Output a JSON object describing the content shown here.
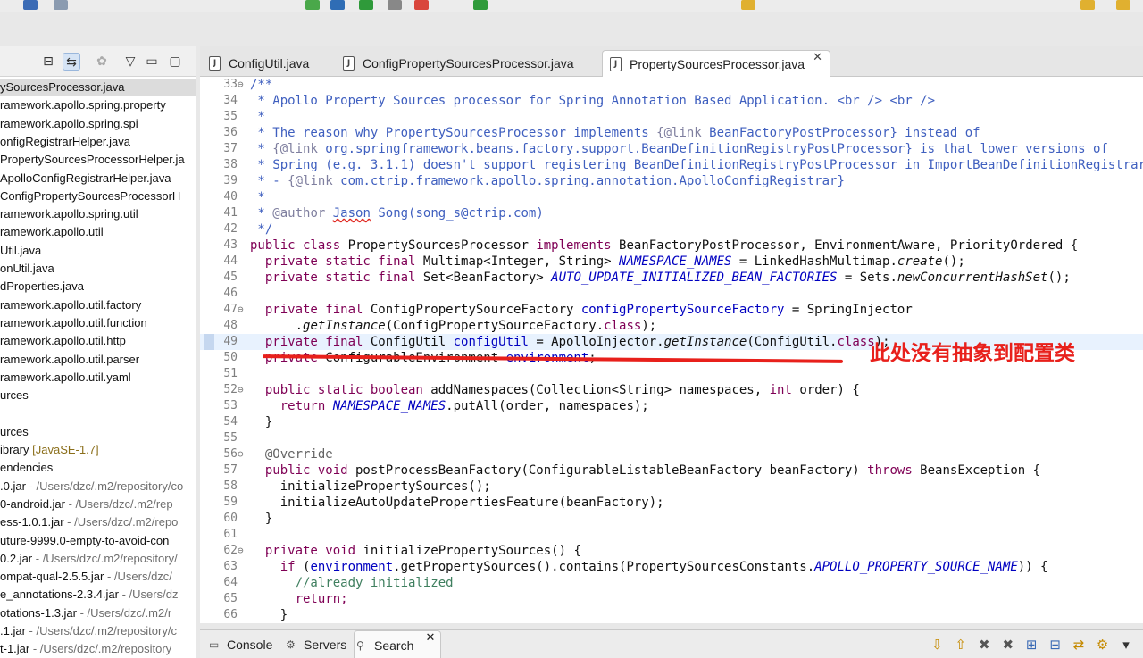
{
  "toolbar": {
    "icons": [
      "save-icon",
      "search-tool-icon",
      "debug-icon",
      "run-icon",
      "new-class-icon",
      "open-type-icon",
      "search-icon",
      "next-annotation-icon",
      "back-icon",
      "forward-icon"
    ]
  },
  "package_explorer": {
    "items": [
      {
        "label": "ySourcesProcessor.java",
        "selected": true
      },
      {
        "label": "ramework.apollo.spring.property"
      },
      {
        "label": "ramework.apollo.spring.spi"
      },
      {
        "label": "onfigRegistrarHelper.java"
      },
      {
        "label": "PropertySourcesProcessorHelper.ja"
      },
      {
        "label": "ApolloConfigRegistrarHelper.java"
      },
      {
        "label": "ConfigPropertySourcesProcessorH"
      },
      {
        "label": "ramework.apollo.spring.util"
      },
      {
        "label": "ramework.apollo.util"
      },
      {
        "label": "Util.java"
      },
      {
        "label": "onUtil.java"
      },
      {
        "label": "dProperties.java"
      },
      {
        "label": "ramework.apollo.util.factory"
      },
      {
        "label": "ramework.apollo.util.function"
      },
      {
        "label": "ramework.apollo.util.http"
      },
      {
        "label": "ramework.apollo.util.parser"
      },
      {
        "label": "ramework.apollo.util.yaml"
      },
      {
        "label": "urces"
      },
      {
        "label": ""
      },
      {
        "label": "urces"
      },
      {
        "label": "ibrary ",
        "lib": "[JavaSE-1.7]"
      },
      {
        "label": "endencies"
      },
      {
        "label": ".0.jar",
        "path": " - /Users/dzc/.m2/repository/co"
      },
      {
        "label": "0-android.jar",
        "path": " - /Users/dzc/.m2/rep"
      },
      {
        "label": "ess-1.0.1.jar",
        "path": " - /Users/dzc/.m2/repo"
      },
      {
        "label": "uture-9999.0-empty-to-avoid-con"
      },
      {
        "label": "0.2.jar",
        "path": " - /Users/dzc/.m2/repository/"
      },
      {
        "label": "ompat-qual-2.5.5.jar",
        "path": " - /Users/dzc/"
      },
      {
        "label": "e_annotations-2.3.4.jar",
        "path": " - /Users/dz"
      },
      {
        "label": "otations-1.3.jar",
        "path": " - /Users/dzc/.m2/r"
      },
      {
        "label": ".1.jar",
        "path": " - /Users/dzc/.m2/repository/c"
      },
      {
        "label": "t-1.jar",
        "path": " - /Users/dzc/.m2/repository"
      }
    ]
  },
  "editor_tabs": [
    {
      "label": "ConfigUtil.java",
      "active": false
    },
    {
      "label": "ConfigPropertySourcesProcessor.java",
      "active": false
    },
    {
      "label": "PropertySourcesProcessor.java",
      "active": true,
      "close": "✕"
    }
  ],
  "code_lines": {
    "l33": "/**",
    "l34": " * Apollo Property Sources processor for Spring Annotation Based Application. <br /> <br />",
    "l35": " *",
    "l36a": " * The reason why PropertySourcesProcessor implements ",
    "l36b": "{@link",
    "l36c": " BeanFactoryPostProcessor} instead of",
    "l37a": " * ",
    "l37b": "{@link",
    "l37c": " org.springframework.beans.factory.support.BeanDefinitionRegistryPostProcessor} is that lower versions of",
    "l38": " * Spring (e.g. 3.1.1) doesn't support registering BeanDefinitionRegistryPostProcessor in ImportBeanDefinitionRegistrar",
    "l39a": " * - ",
    "l39b": "{@link",
    "l39c": " com.ctrip.framework.apollo.spring.annotation.ApolloConfigRegistrar}",
    "l40": " *",
    "l41a": " * ",
    "l41b": "@author",
    "l41c": " ",
    "l41d": "Jason",
    "l41e": " Song(song_s@ctrip.com)",
    "l42": " */",
    "l43a": "public class",
    "l43b": " PropertySourcesProcessor ",
    "l43c": "implements",
    "l43d": " BeanFactoryPostProcessor, EnvironmentAware, PriorityOrdered {",
    "l44a": "  private static final",
    "l44b": " Multimap<Integer, String> ",
    "l44c": "NAMESPACE_NAMES",
    "l44d": " = LinkedHashMultimap.",
    "l44e": "create",
    "l44f": "();",
    "l45a": "  private static final",
    "l45b": " Set<BeanFactory> ",
    "l45c": "AUTO_UPDATE_INITIALIZED_BEAN_FACTORIES",
    "l45d": " = Sets.",
    "l45e": "newConcurrentHashSet",
    "l45f": "();",
    "l46": "",
    "l47a": "  private final",
    "l47b": " ConfigPropertySourceFactory ",
    "l47c": "configPropertySourceFactory",
    "l47d": " = SpringInjector",
    "l48a": "      .",
    "l48b": "getInstance",
    "l48c": "(ConfigPropertySourceFactory.",
    "l48d": "class",
    "l48e": ");",
    "l49a": "  private final",
    "l49b": " ConfigUtil ",
    "l49c": "configUtil",
    "l49d": " = ApolloInjector.",
    "l49e": "getInstance",
    "l49f": "(ConfigUtil.",
    "l49g": "class",
    "l49h": ");",
    "l50a": "  private",
    "l50b": " ConfigurableEnvironment ",
    "l50c": "environment",
    "l50d": ";",
    "l51": "",
    "l52a": "  public static boolean",
    "l52b": " addNamespaces(Collection<String> namespaces, ",
    "l52c": "int",
    "l52d": " order) {",
    "l53a": "    return ",
    "l53b": "NAMESPACE_NAMES",
    "l53c": ".putAll(order, namespaces);",
    "l54": "  }",
    "l55": "",
    "l56": "  @Override",
    "l57a": "  public void",
    "l57b": " postProcessBeanFactory(ConfigurableListableBeanFactory beanFactory) ",
    "l57c": "throws",
    "l57d": " BeansException {",
    "l58": "    initializePropertySources();",
    "l59": "    initializeAutoUpdatePropertiesFeature(beanFactory);",
    "l60": "  }",
    "l61": "",
    "l62a": "  private void",
    "l62b": " initializePropertySources() {",
    "l63a": "    if",
    "l63b": " (",
    "l63c": "environment",
    "l63d": ".getPropertySources().contains(PropertySourcesConstants.",
    "l63e": "APOLLO_PROPERTY_SOURCE_NAME",
    "l63f": ")) {",
    "l64": "      //already initialized",
    "l65": "      return;",
    "l66": "    }"
  },
  "line_numbers": [
    "33",
    "34",
    "35",
    "36",
    "37",
    "38",
    "39",
    "40",
    "41",
    "42",
    "43",
    "44",
    "45",
    "46",
    "47",
    "48",
    "49",
    "50",
    "51",
    "52",
    "53",
    "54",
    "55",
    "56",
    "57",
    "58",
    "59",
    "60",
    "61",
    "62",
    "63",
    "64",
    "65",
    "66"
  ],
  "annotation": {
    "text": "此处没有抽象到配置类",
    "color": "#e8201b"
  },
  "bottom_tabs": [
    {
      "label": "Console",
      "icon": "console-icon"
    },
    {
      "label": "Servers",
      "icon": "servers-icon"
    },
    {
      "label": "Search",
      "icon": "search-icon",
      "active": true,
      "close": "✕"
    }
  ],
  "bottom_icons": [
    "⇩",
    "⇧",
    "✖",
    "✖",
    "⊞",
    "⊟",
    "⇄",
    "⚙",
    "▾"
  ]
}
